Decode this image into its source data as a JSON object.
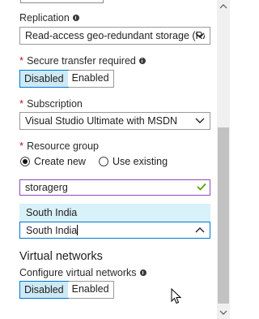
{
  "replication": {
    "label": "Replication",
    "value": "Read-access geo-redundant storage (RA-..."
  },
  "secure_transfer": {
    "required_mark": "*",
    "label": "Secure transfer required",
    "options": [
      "Disabled",
      "Enabled"
    ],
    "selected": "Disabled"
  },
  "subscription": {
    "required_mark": "*",
    "label": "Subscription",
    "value": "Visual Studio Ultimate with MSDN"
  },
  "resource_group": {
    "required_mark": "*",
    "label": "Resource group",
    "create_new_label": "Create new",
    "use_existing_label": "Use existing",
    "selected_option": "Create new",
    "name_value": "storagerg"
  },
  "location": {
    "highlighted_option": "South India",
    "value": "South India"
  },
  "virtual_networks": {
    "title": "Virtual networks",
    "configure_label": "Configure virtual networks",
    "options": [
      "Disabled",
      "Enabled"
    ],
    "selected": "Disabled"
  },
  "colors": {
    "accent": "#0078d4",
    "selected_fill": "#cde9f4",
    "required": "#c50f1f",
    "valid": "#57a300",
    "input_focus": "#8e4bb5"
  }
}
